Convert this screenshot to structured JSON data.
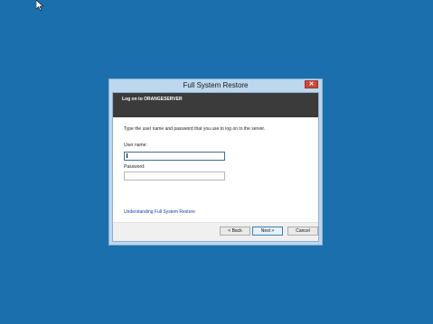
{
  "window": {
    "title": "Full System Restore",
    "close_label": "✕"
  },
  "header": {
    "title": "Log on to ORANGESERVER"
  },
  "main": {
    "instructions": "Type the user name and password that you use to log on to the server.",
    "username_label": "User name:",
    "username_value": "",
    "password_label": "Password:",
    "password_value": "",
    "help_link": "Understanding Full System Restore"
  },
  "footer": {
    "back_label": "< Back",
    "next_label": "Next >",
    "cancel_label": "Cancel"
  },
  "colors": {
    "desktop": "#1b6fac",
    "header_band": "#3b3b3b",
    "close_button": "#c9483c",
    "link": "#1a3da8"
  },
  "icons": {
    "cursor": "mouse-pointer-icon",
    "close": "close-icon"
  }
}
